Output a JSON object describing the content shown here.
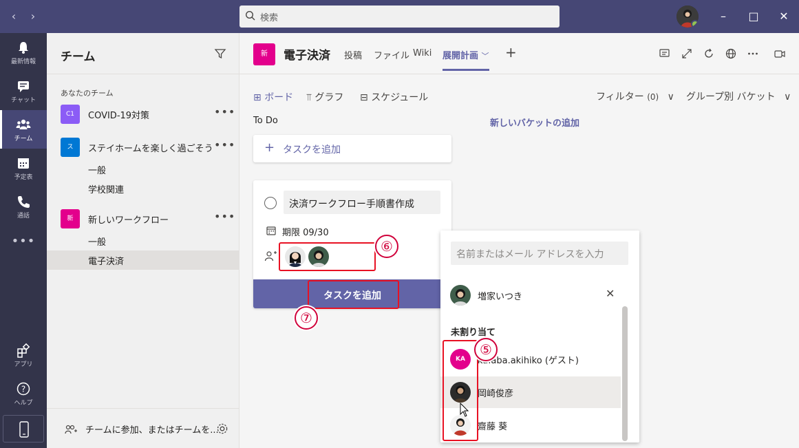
{
  "titlebar": {
    "search_placeholder": "検索",
    "back_icon": "chevron-left-icon",
    "forward_icon": "chevron-right-icon"
  },
  "rail": {
    "items": [
      {
        "label": "最新情報",
        "icon": "bell-icon"
      },
      {
        "label": "チャット",
        "icon": "chat-icon"
      },
      {
        "label": "チーム",
        "icon": "teams-icon"
      },
      {
        "label": "予定表",
        "icon": "calendar-icon"
      },
      {
        "label": "通話",
        "icon": "phone-icon"
      },
      {
        "label": "アプリ",
        "icon": "apps-icon"
      },
      {
        "label": "ヘルプ",
        "icon": "help-icon"
      }
    ]
  },
  "teams_panel": {
    "title": "チーム",
    "section_label": "あなたのチーム",
    "teams": [
      {
        "avatar": "C1",
        "name": "COVID-19対策",
        "color": "#8b5cf6"
      },
      {
        "avatar": "ス",
        "name": "ステイホームを楽しく過ごそう",
        "color": "#0078d4"
      },
      {
        "avatar": "新",
        "name": "新しいワークフロー",
        "color": "#e3008c"
      }
    ],
    "channels_team2": [
      "一般",
      "学校関連"
    ],
    "channels_team3": [
      "一般",
      "電子決済"
    ],
    "footer_text": "チームに参加、またはチームを..."
  },
  "channel_header": {
    "avatar": "新",
    "name": "電子決済",
    "tabs": [
      "投稿",
      "ファイル",
      "Wiki",
      "展開計画"
    ],
    "active_tab_arrow": "﹀"
  },
  "planner": {
    "views": [
      "ボード",
      "グラフ",
      "スケジュール"
    ],
    "filter_label": "フィルター",
    "filter_count": "(0)",
    "group_label": "グループ別 バケット",
    "bucket_title": "To Do",
    "add_bucket": "新しいバケットの追加",
    "add_task_label": "タスクを追加",
    "task": {
      "title": "決済ワークフロー手順書作成",
      "due": "期限 09/30",
      "add_button": "タスクを追加"
    },
    "callouts": [
      "⑥",
      "⑦",
      "⑤"
    ]
  },
  "picker": {
    "placeholder": "名前またはメール アドレスを入力",
    "assigned": [
      {
        "name": "増家いつき"
      }
    ],
    "section": "未割り当て",
    "unassigned": [
      {
        "initials": "KA",
        "name": "ka.aba.akihiko (ゲスト)"
      },
      {
        "name": "岡崎俊彦"
      },
      {
        "name": "齋藤 葵"
      }
    ]
  },
  "colors": {
    "brand": "#6264a7",
    "titlebar": "#464775",
    "rail": "#33344a",
    "highlight": "#e81123"
  }
}
